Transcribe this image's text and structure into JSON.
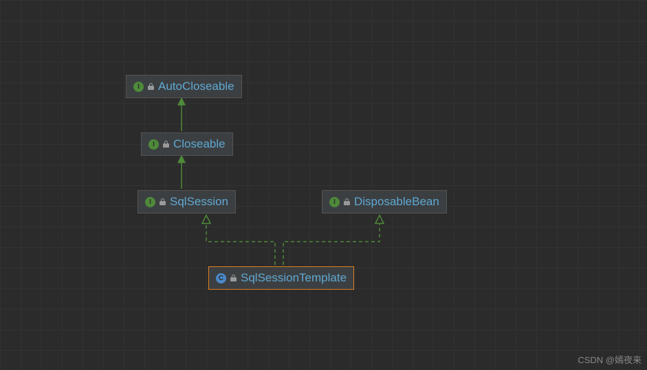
{
  "diagram": {
    "nodes": {
      "autoCloseable": {
        "label": "AutoCloseable",
        "kind": "interface"
      },
      "closeable": {
        "label": "Closeable",
        "kind": "interface"
      },
      "sqlSession": {
        "label": "SqlSession",
        "kind": "interface"
      },
      "disposableBean": {
        "label": "DisposableBean",
        "kind": "interface"
      },
      "sqlSessionTemplate": {
        "label": "SqlSessionTemplate",
        "kind": "class",
        "selected": true
      }
    },
    "relationships": [
      {
        "from": "closeable",
        "to": "autoCloseable",
        "type": "extends"
      },
      {
        "from": "sqlSession",
        "to": "closeable",
        "type": "extends"
      },
      {
        "from": "sqlSessionTemplate",
        "to": "sqlSession",
        "type": "implements"
      },
      {
        "from": "sqlSessionTemplate",
        "to": "disposableBean",
        "type": "implements"
      }
    ]
  },
  "icons": {
    "interfaceLetter": "I",
    "classLetter": "C"
  },
  "watermark": "CSDN @嫣夜来"
}
